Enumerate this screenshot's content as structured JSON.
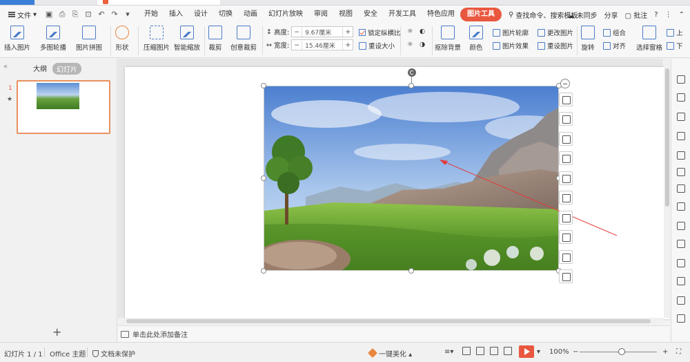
{
  "menubar": {
    "file_label": "文件",
    "tabs": [
      "开始",
      "插入",
      "设计",
      "切换",
      "动画",
      "幻灯片放映",
      "审阅",
      "视图",
      "安全",
      "开发工具",
      "特色应用",
      "图片工具"
    ],
    "active_tab_index": 11,
    "search_label": "查找命令、搜索模板",
    "sync_label": "未同步",
    "share_label": "分享",
    "comment_label": "批注",
    "help_label": "?"
  },
  "ribbon": {
    "insert_picture": "插入图片",
    "multi_outline": "多图轮播",
    "picture_collage": "图片拼图",
    "shape": "形状",
    "compress": "压缩图片",
    "smart_zoom": "智能缩放",
    "crop": "裁剪",
    "creative_crop": "创意裁剪",
    "height_label": "高度:",
    "height_value": "9.67厘米",
    "width_label": "宽度:",
    "width_value": "15.46厘米",
    "lock_ratio": "锁定纵横比",
    "reset_size": "重设大小",
    "remove_bg": "抠除背景",
    "color": "颜色",
    "picture_outline": "图片轮廓",
    "picture_effect": "图片效果",
    "change_picture": "更改图片",
    "reset_picture": "重设图片",
    "rotate": "旋转",
    "group": "组合",
    "align": "对齐",
    "selection_pane": "选择窗格",
    "up": "上",
    "down": "下"
  },
  "leftpanel": {
    "tab_outline": "大纲",
    "tab_slides": "幻灯片",
    "slide_number": "1",
    "star": "★"
  },
  "notes": {
    "placeholder": "单击此处添加备注"
  },
  "statusbar": {
    "slide_info": "幻灯片 1 / 1",
    "theme": "Office 主题",
    "protection": "文档未保护",
    "beautify": "一键美化",
    "zoom": "100%",
    "minus": "−",
    "plus": "+"
  },
  "colors": {
    "accent": "#e9573f",
    "selection": "#e9905f",
    "icon_blue": "#4a7bc8"
  }
}
